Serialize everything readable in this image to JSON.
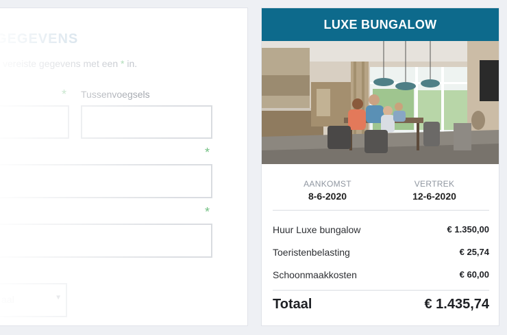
{
  "form": {
    "title": "GEGEVENS",
    "hint_prefix": "vereiste gegevens met een ",
    "hint_star": "*",
    "hint_suffix": " in.",
    "required_star": "*",
    "tussenvoegsels_label": "Tussenvoegsels",
    "select_value": "aal"
  },
  "booking": {
    "title": "LUXE BUNGALOW",
    "photo_alt": "Interieur van een luxe bungalow met familie aan tafel",
    "arrival_label": "AANKOMST",
    "arrival_date": "8-6-2020",
    "departure_label": "VERTREK",
    "departure_date": "12-6-2020",
    "costs": [
      {
        "label": "Huur Luxe bungalow",
        "amount": "€ 1.350,00"
      },
      {
        "label": "Toeristenbelasting",
        "amount": "€ 25,74"
      },
      {
        "label": "Schoonmaakkosten",
        "amount": "€ 60,00"
      }
    ],
    "total_label": "Totaal",
    "total_amount": "€ 1.435,74"
  },
  "colors": {
    "header": "#0d6a8c",
    "required": "#66bb78",
    "page_bg": "#eef0f4"
  }
}
